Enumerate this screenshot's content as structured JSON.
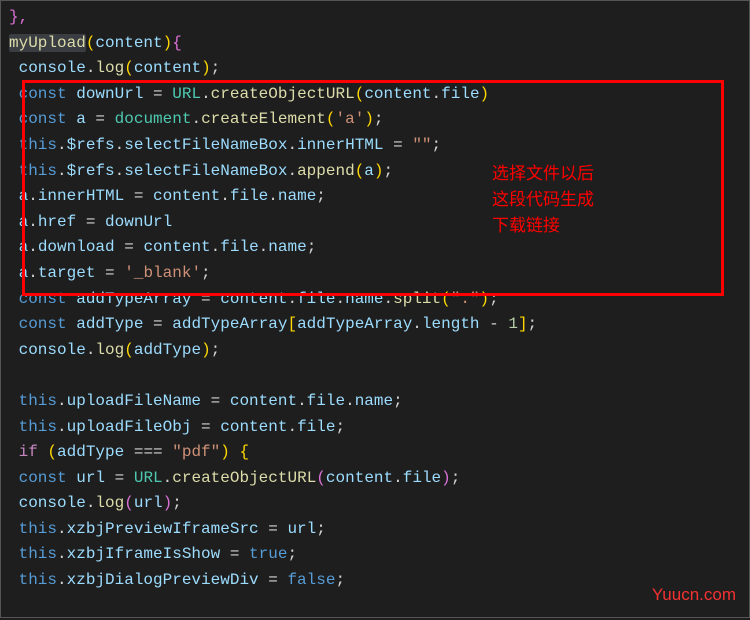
{
  "lines": [
    [
      [
        "bp",
        "},"
      ]
    ],
    [
      [
        "sel-fn",
        "myUpload"
      ],
      [
        "by",
        "("
      ],
      [
        "vr",
        "content"
      ],
      [
        "by",
        ")"
      ],
      [
        "bp",
        "{"
      ]
    ],
    [
      [
        "idn",
        "  "
      ],
      [
        "vr",
        "console"
      ],
      [
        "pn",
        "."
      ],
      [
        "fn",
        "log"
      ],
      [
        "by",
        "("
      ],
      [
        "vr",
        "content"
      ],
      [
        "by",
        ")"
      ],
      [
        "pn",
        ";"
      ]
    ],
    [
      [
        "idn",
        "  "
      ],
      [
        "kw",
        "const"
      ],
      [
        "pn",
        " "
      ],
      [
        "vr",
        "downUrl"
      ],
      [
        "pn",
        " = "
      ],
      [
        "tp",
        "URL"
      ],
      [
        "pn",
        "."
      ],
      [
        "fn",
        "createObjectURL"
      ],
      [
        "by",
        "("
      ],
      [
        "vr",
        "content"
      ],
      [
        "pn",
        "."
      ],
      [
        "vr",
        "file"
      ],
      [
        "by",
        ")"
      ]
    ],
    [
      [
        "idn",
        "  "
      ],
      [
        "kw",
        "const"
      ],
      [
        "pn",
        " "
      ],
      [
        "vr",
        "a"
      ],
      [
        "pn",
        " = "
      ],
      [
        "tp",
        "document"
      ],
      [
        "pn",
        "."
      ],
      [
        "fn",
        "createElement"
      ],
      [
        "by",
        "("
      ],
      [
        "st",
        "'a'"
      ],
      [
        "by",
        ")"
      ],
      [
        "pn",
        ";"
      ]
    ],
    [
      [
        "idn",
        "  "
      ],
      [
        "kw",
        "this"
      ],
      [
        "pn",
        "."
      ],
      [
        "vr",
        "$refs"
      ],
      [
        "pn",
        "."
      ],
      [
        "vr",
        "selectFileNameBox"
      ],
      [
        "pn",
        "."
      ],
      [
        "vr",
        "innerHTML"
      ],
      [
        "pn",
        " = "
      ],
      [
        "st",
        "\"\""
      ],
      [
        "pn",
        ";"
      ]
    ],
    [
      [
        "idn",
        "  "
      ],
      [
        "kw",
        "this"
      ],
      [
        "pn",
        "."
      ],
      [
        "vr",
        "$refs"
      ],
      [
        "pn",
        "."
      ],
      [
        "vr",
        "selectFileNameBox"
      ],
      [
        "pn",
        "."
      ],
      [
        "fn",
        "append"
      ],
      [
        "by",
        "("
      ],
      [
        "vr",
        "a"
      ],
      [
        "by",
        ")"
      ],
      [
        "pn",
        ";"
      ]
    ],
    [
      [
        "idn",
        "  "
      ],
      [
        "vr",
        "a"
      ],
      [
        "pn",
        "."
      ],
      [
        "vr",
        "innerHTML"
      ],
      [
        "pn",
        " = "
      ],
      [
        "vr",
        "content"
      ],
      [
        "pn",
        "."
      ],
      [
        "vr",
        "file"
      ],
      [
        "pn",
        "."
      ],
      [
        "vr",
        "name"
      ],
      [
        "pn",
        ";"
      ]
    ],
    [
      [
        "idn",
        "  "
      ],
      [
        "vr",
        "a"
      ],
      [
        "pn",
        "."
      ],
      [
        "vr",
        "href"
      ],
      [
        "pn",
        " = "
      ],
      [
        "vr",
        "downUrl"
      ]
    ],
    [
      [
        "idn",
        "  "
      ],
      [
        "vr",
        "a"
      ],
      [
        "pn",
        "."
      ],
      [
        "vr",
        "download"
      ],
      [
        "pn",
        " = "
      ],
      [
        "vr",
        "content"
      ],
      [
        "pn",
        "."
      ],
      [
        "vr",
        "file"
      ],
      [
        "pn",
        "."
      ],
      [
        "vr",
        "name"
      ],
      [
        "pn",
        ";"
      ]
    ],
    [
      [
        "idn",
        "  "
      ],
      [
        "vr",
        "a"
      ],
      [
        "pn",
        "."
      ],
      [
        "vr",
        "target"
      ],
      [
        "pn",
        " = "
      ],
      [
        "st",
        "'_blank'"
      ],
      [
        "pn",
        ";"
      ]
    ],
    [
      [
        "idn",
        "  "
      ],
      [
        "kw",
        "const"
      ],
      [
        "pn",
        " "
      ],
      [
        "vr",
        "addTypeArray"
      ],
      [
        "pn",
        " = "
      ],
      [
        "vr",
        "content"
      ],
      [
        "pn",
        "."
      ],
      [
        "vr",
        "file"
      ],
      [
        "pn",
        "."
      ],
      [
        "vr",
        "name"
      ],
      [
        "pn",
        "."
      ],
      [
        "fn",
        "split"
      ],
      [
        "by",
        "("
      ],
      [
        "st",
        "\".\""
      ],
      [
        "by",
        ")"
      ],
      [
        "pn",
        ";"
      ]
    ],
    [
      [
        "idn",
        "  "
      ],
      [
        "kw",
        "const"
      ],
      [
        "pn",
        " "
      ],
      [
        "vr",
        "addType"
      ],
      [
        "pn",
        " = "
      ],
      [
        "vr",
        "addTypeArray"
      ],
      [
        "by",
        "["
      ],
      [
        "vr",
        "addTypeArray"
      ],
      [
        "pn",
        "."
      ],
      [
        "vr",
        "length"
      ],
      [
        "pn",
        " - "
      ],
      [
        "nm",
        "1"
      ],
      [
        "by",
        "]"
      ],
      [
        "pn",
        ";"
      ]
    ],
    [
      [
        "idn",
        "  "
      ],
      [
        "vr",
        "console"
      ],
      [
        "pn",
        "."
      ],
      [
        "fn",
        "log"
      ],
      [
        "by",
        "("
      ],
      [
        "vr",
        "addType"
      ],
      [
        "by",
        ")"
      ],
      [
        "pn",
        ";"
      ]
    ],
    [
      [
        "pn",
        " "
      ]
    ],
    [
      [
        "idn",
        "  "
      ],
      [
        "kw",
        "this"
      ],
      [
        "pn",
        "."
      ],
      [
        "vr",
        "uploadFileName"
      ],
      [
        "pn",
        " = "
      ],
      [
        "vr",
        "content"
      ],
      [
        "pn",
        "."
      ],
      [
        "vr",
        "file"
      ],
      [
        "pn",
        "."
      ],
      [
        "vr",
        "name"
      ],
      [
        "pn",
        ";"
      ]
    ],
    [
      [
        "idn",
        "  "
      ],
      [
        "kw",
        "this"
      ],
      [
        "pn",
        "."
      ],
      [
        "vr",
        "uploadFileObj"
      ],
      [
        "pn",
        " = "
      ],
      [
        "vr",
        "content"
      ],
      [
        "pn",
        "."
      ],
      [
        "vr",
        "file"
      ],
      [
        "pn",
        ";"
      ]
    ],
    [
      [
        "idn",
        "  "
      ],
      [
        "cf",
        "if"
      ],
      [
        "pn",
        " "
      ],
      [
        "by",
        "("
      ],
      [
        "vr",
        "addType"
      ],
      [
        "pn",
        " === "
      ],
      [
        "st",
        "\"pdf\""
      ],
      [
        "by",
        ")"
      ],
      [
        "pn",
        " "
      ],
      [
        "by",
        "{"
      ]
    ],
    [
      [
        "idn",
        "    "
      ],
      [
        "kw",
        "const"
      ],
      [
        "pn",
        " "
      ],
      [
        "vr",
        "url"
      ],
      [
        "pn",
        " = "
      ],
      [
        "tp",
        "URL"
      ],
      [
        "pn",
        "."
      ],
      [
        "fn",
        "createObjectURL"
      ],
      [
        "bp",
        "("
      ],
      [
        "vr",
        "content"
      ],
      [
        "pn",
        "."
      ],
      [
        "vr",
        "file"
      ],
      [
        "bp",
        ")"
      ],
      [
        "pn",
        ";"
      ]
    ],
    [
      [
        "idn",
        "    "
      ],
      [
        "vr",
        "console"
      ],
      [
        "pn",
        "."
      ],
      [
        "fn",
        "log"
      ],
      [
        "bp",
        "("
      ],
      [
        "vr",
        "url"
      ],
      [
        "bp",
        ")"
      ],
      [
        "pn",
        ";"
      ]
    ],
    [
      [
        "idn",
        "    "
      ],
      [
        "kw",
        "this"
      ],
      [
        "pn",
        "."
      ],
      [
        "vr",
        "xzbjPreviewIframeSrc"
      ],
      [
        "pn",
        " = "
      ],
      [
        "vr",
        "url"
      ],
      [
        "pn",
        ";"
      ]
    ],
    [
      [
        "idn",
        "    "
      ],
      [
        "kw",
        "this"
      ],
      [
        "pn",
        "."
      ],
      [
        "vr",
        "xzbjIframeIsShow"
      ],
      [
        "pn",
        " = "
      ],
      [
        "kw",
        "true"
      ],
      [
        "pn",
        ";"
      ]
    ],
    [
      [
        "idn",
        "    "
      ],
      [
        "kw",
        "this"
      ],
      [
        "pn",
        "."
      ],
      [
        "vr",
        "xzbjDialogPreviewDiv"
      ],
      [
        "pn",
        " = "
      ],
      [
        "kw",
        "false"
      ],
      [
        "pn",
        ";"
      ]
    ]
  ],
  "annotations": {
    "a1": "选择文件以后",
    "a2": "这段代码生成",
    "a3": "下载链接"
  },
  "watermark": "Yuucn.com"
}
